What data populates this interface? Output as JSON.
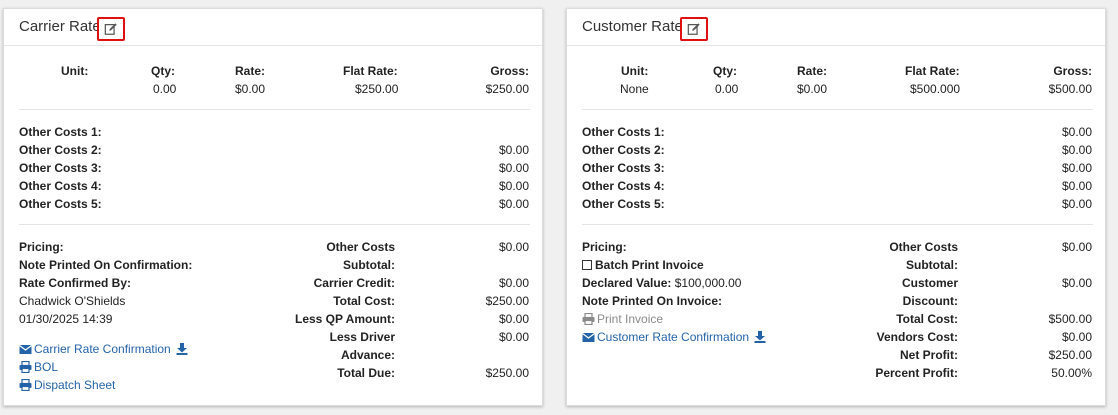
{
  "carrier": {
    "title": "Carrier Rate",
    "headers": {
      "unit": "Unit:",
      "qty": "Qty:",
      "rate": "Rate:",
      "flat": "Flat Rate:",
      "gross": "Gross:"
    },
    "values": {
      "unit": "",
      "qty": "0.00",
      "rate": "$0.00",
      "flat": "$250.00",
      "gross": "$250.00"
    },
    "other_costs": [
      {
        "label": "Other Costs 1:",
        "value": ""
      },
      {
        "label": "Other Costs 2:",
        "value": "$0.00"
      },
      {
        "label": "Other Costs 3:",
        "value": "$0.00"
      },
      {
        "label": "Other Costs 4:",
        "value": "$0.00"
      },
      {
        "label": "Other Costs 5:",
        "value": "$0.00"
      }
    ],
    "pricing_label": "Pricing:",
    "note_label": "Note Printed On Confirmation:",
    "confirmed_by_label": "Rate Confirmed By:",
    "confirmed_by_name": "Chadwick O'Shields",
    "confirmed_date": "01/30/2025 14:39",
    "links": {
      "rate_confirmation": "Carrier Rate Confirmation",
      "bol": "BOL",
      "dispatch": "Dispatch Sheet"
    },
    "summary": [
      {
        "label": "Other Costs",
        "value": "$0.00"
      },
      {
        "label": "Subtotal:",
        "value": ""
      },
      {
        "label": "Carrier Credit:",
        "value": "$0.00"
      },
      {
        "label": "Total Cost:",
        "value": "$250.00"
      },
      {
        "label": "Less QP Amount:",
        "value": "$0.00"
      },
      {
        "label": "Less Driver",
        "value": "$0.00"
      },
      {
        "label": "Advance:",
        "value": ""
      },
      {
        "label": "Total Due:",
        "value": "$250.00"
      }
    ]
  },
  "customer": {
    "title": "Customer Rate",
    "headers": {
      "unit": "Unit:",
      "qty": "Qty:",
      "rate": "Rate:",
      "flat": "Flat Rate:",
      "gross": "Gross:"
    },
    "values": {
      "unit": "None",
      "qty": "0.00",
      "rate": "$0.00",
      "flat": "$500.000",
      "gross": "$500.00"
    },
    "other_costs": [
      {
        "label": "Other Costs 1:",
        "value": "$0.00"
      },
      {
        "label": "Other Costs 2:",
        "value": "$0.00"
      },
      {
        "label": "Other Costs 3:",
        "value": "$0.00"
      },
      {
        "label": "Other Costs 4:",
        "value": "$0.00"
      },
      {
        "label": "Other Costs 5:",
        "value": "$0.00"
      }
    ],
    "pricing_label": "Pricing:",
    "batch_print_label": "Batch Print Invoice",
    "declared_value_label": "Declared Value:",
    "declared_value": "$100,000.00",
    "note_label": "Note Printed On Invoice:",
    "links": {
      "print_invoice": "Print Invoice",
      "rate_confirmation": "Customer Rate Confirmation"
    },
    "summary": [
      {
        "label": "Other Costs",
        "value": "$0.00"
      },
      {
        "label": "Subtotal:",
        "value": ""
      },
      {
        "label": "Customer",
        "value": "$0.00"
      },
      {
        "label": "Discount:",
        "value": ""
      },
      {
        "label": "Total Cost:",
        "value": "$500.00"
      },
      {
        "label": "Vendors Cost:",
        "value": "$0.00"
      },
      {
        "label": "Net Profit:",
        "value": "$250.00"
      },
      {
        "label": "Percent Profit:",
        "value": "50.00%"
      }
    ]
  },
  "colors": {
    "highlight": "#e01010",
    "link": "#2563a8",
    "muted_link": "#8a8a8a"
  },
  "icons": [
    "edit-icon",
    "envelope-icon",
    "download-icon",
    "print-icon",
    "checkbox-icon"
  ]
}
